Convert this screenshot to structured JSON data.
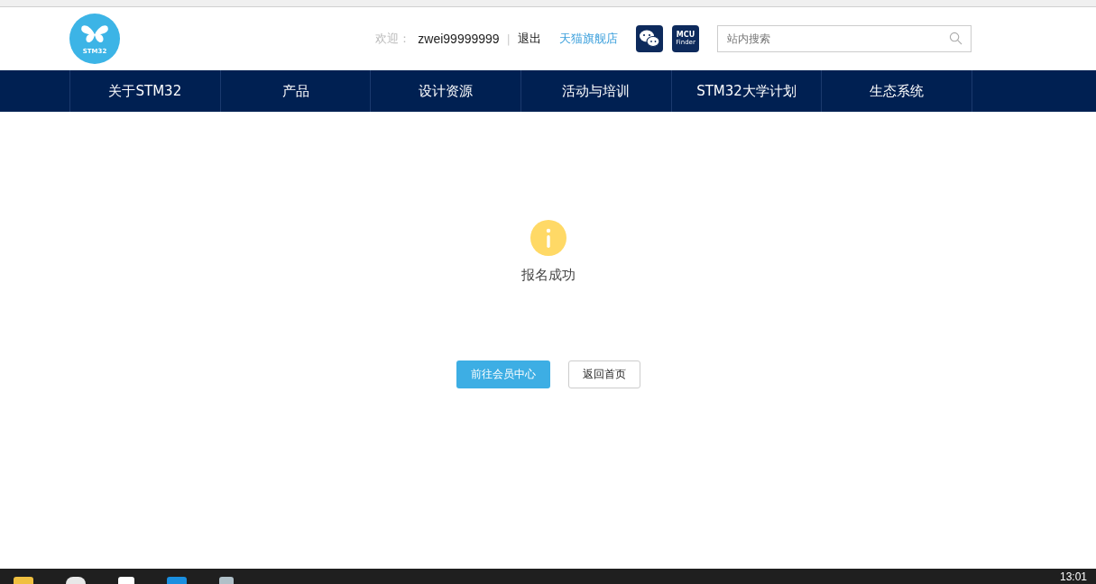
{
  "header": {
    "logo_text": "STM32",
    "welcome_label": "欢迎：",
    "username": "zwei99999999",
    "separator": "|",
    "logout": "退出",
    "store_link": "天猫旗舰店",
    "mcu_finder": {
      "line1": "MCU",
      "line2": "Finder"
    },
    "search": {
      "placeholder": "站内搜索"
    }
  },
  "nav": [
    {
      "label": "关于STM32"
    },
    {
      "label": "产品"
    },
    {
      "label": "设计资源"
    },
    {
      "label": "活动与培训"
    },
    {
      "label": "STM32大学计划"
    },
    {
      "label": "生态系统"
    }
  ],
  "result": {
    "message": "报名成功",
    "buttons": [
      {
        "label": "前往会员中心",
        "kind": "primary"
      },
      {
        "label": "返回首页",
        "kind": "secondary"
      }
    ]
  },
  "taskbar": {
    "time": "13:01"
  }
}
